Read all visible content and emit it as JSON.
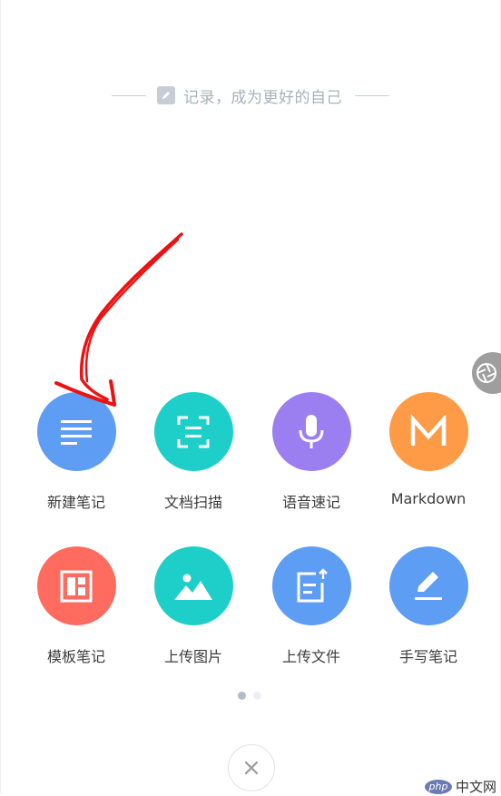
{
  "slogan": {
    "text": "记录，成为更好的自己",
    "icon": "pencil-icon"
  },
  "actions": [
    {
      "label": "新建笔记",
      "icon": "lines-icon",
      "color": "#5e9df4"
    },
    {
      "label": "文档扫描",
      "icon": "scan-icon",
      "color": "#1dcfc8"
    },
    {
      "label": "语音速记",
      "icon": "microphone-icon",
      "color": "#9b7ff0"
    },
    {
      "label": "Markdown",
      "icon": "m-letter-icon",
      "color": "#ff9a47"
    },
    {
      "label": "模板笔记",
      "icon": "template-icon",
      "color": "#ff6b5e"
    },
    {
      "label": "上传图片",
      "icon": "image-icon",
      "color": "#1dcfc8"
    },
    {
      "label": "上传文件",
      "icon": "file-upload-icon",
      "color": "#5e9df4"
    },
    {
      "label": "手写笔记",
      "icon": "handwrite-icon",
      "color": "#5e9df4"
    }
  ],
  "pagination": {
    "pages": 2,
    "current": 1,
    "active_color": "#b3bcc6",
    "inactive_color": "#eceff2"
  },
  "close": {
    "icon": "close-icon"
  },
  "floating": {
    "icon": "shutter-icon"
  },
  "watermark": {
    "logo": "php",
    "text": "中文网"
  }
}
